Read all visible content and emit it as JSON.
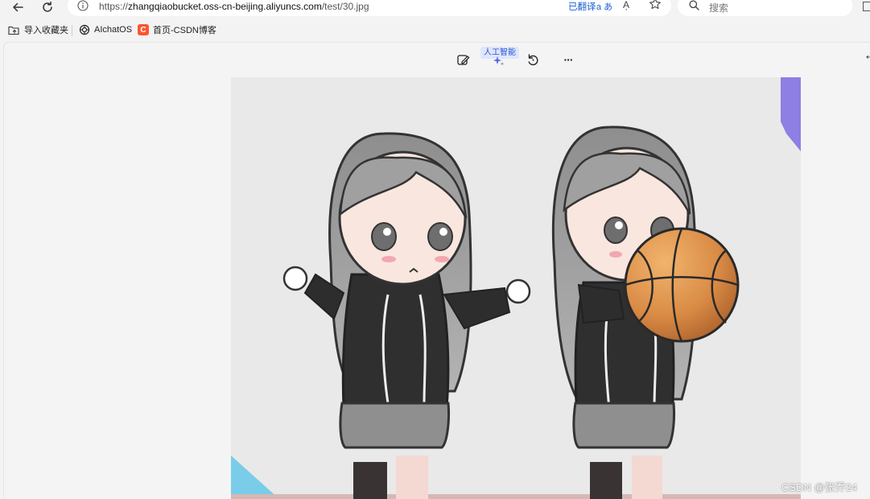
{
  "browser": {
    "url_prefix": "https://",
    "url_host": "zhangqiaobucket.oss-cn-beijing.aliyuncs.com",
    "url_path": "/test/30.jpg",
    "translate_label": "已翻译",
    "translate_icon": "a あ",
    "read_aloud_icon": "Aͅ",
    "search_placeholder": "搜索"
  },
  "bookmarks": {
    "items": [
      {
        "label": "导入收藏夹",
        "icon": "folder-import-icon"
      },
      {
        "label": "AIchatOS",
        "icon": "openai-icon"
      },
      {
        "label": "首页-CSDN博客",
        "icon": "csdn-icon",
        "icon_glyph": "C"
      }
    ]
  },
  "viewer": {
    "ai_badge": "人工智能",
    "more_glyph": "···",
    "corner_glyph": "↵"
  },
  "watermark": "CSDN @张乔24",
  "colors": {
    "csdn_red": "#fc5531",
    "accent_blue": "#1a5fd0",
    "ai_badge_bg": "#dfe6fb"
  }
}
